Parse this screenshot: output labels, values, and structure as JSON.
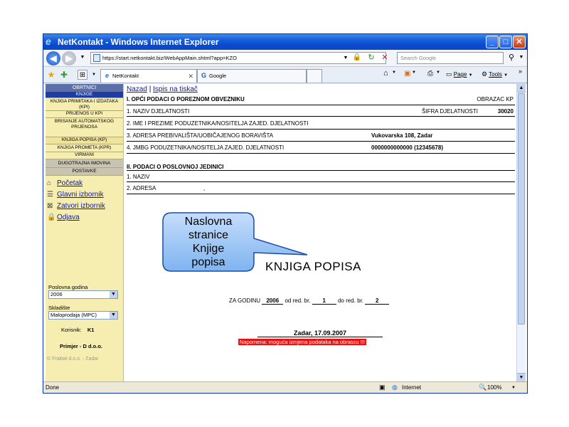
{
  "window": {
    "title": "NetKontakt - Windows Internet Explorer"
  },
  "address_bar": {
    "url": "https://start.netkontakt.biz/WebAppMain.shtml?app=KZO",
    "search_placeholder": "Search Google"
  },
  "tabs": [
    {
      "label": "NetKontakt"
    },
    {
      "label": "Google"
    }
  ],
  "commands": {
    "page": "Page",
    "tools": "Tools"
  },
  "sidebar": {
    "header": "OBRTNICI",
    "items": [
      {
        "label": "KNJIGE"
      },
      {
        "label": "KNJIGA PRIMITAKA I IZDATAKA (KPI)"
      },
      {
        "label": "PRIJENOS U KPI"
      },
      {
        "label": "BRISANJE AUTOMATSKOG PRIJENOSA"
      },
      {
        "label": "KNJIGA POPISA (KP)"
      },
      {
        "label": "KNJIGA PROMETA (KPR)"
      },
      {
        "label": "VIRMANI"
      },
      {
        "label": "DUGOTRAJNA IMOVINA"
      },
      {
        "label": "POSTAVKE"
      }
    ],
    "links": [
      {
        "label": "Početak"
      },
      {
        "label": "Glavni izbornik"
      },
      {
        "label": "Zatvori izbornik"
      },
      {
        "label": "Odjava"
      }
    ],
    "year_label": "Poslovna godina",
    "year_value": "2006",
    "warehouse_label": "Skladište",
    "warehouse_value": "Maloprodaja (MPC)",
    "user_label": "Korisnik:",
    "user_value": "K1",
    "company": "Primjer - D d.o.o.",
    "footer": "© Fraktal d.o.o. - Zadar"
  },
  "main": {
    "nav_back": "Nazad",
    "nav_separator": "|",
    "nav_print": "Ispis na tiskač",
    "section1_title": "I. OPĆI PODACI O POREZNOM OBVEZNIKU",
    "form_code": "OBRAZAC KP",
    "row1_label": "1. NAZIV DJELATNOSTI",
    "row1_code_label": "ŠIFRA DJELATNOSTI",
    "row1_code_value": "30020",
    "row2_label": "2. IME I PREZIME PODUZETNIKA/NOSITELJA ZAJED. DJELATNOSTI",
    "row3_label": "3. ADRESA PREBIVALIŠTA/UOBIČAJENOG BORAVIŠTA",
    "row3_value": "Vukovarska 108, Zadar",
    "row4_label": "4. JMBG PODUZETNIKA/NOSITELJA ZAJED. DJELATNOSTI",
    "row4_value": "0000000000000 (12345678)",
    "section2_title": "II. PODACI O POSLOVNOJ JEDINICI",
    "unit_row1_label": "1. NAZIV",
    "unit_row2_label": "2. ADRESA",
    "unit_row2_value": ",",
    "book_title": "KNJIGA POPISA",
    "year_prefix": "ZA GODINU",
    "year_value": "2006",
    "from_label": "od red. br.",
    "from_value": "1",
    "to_label": "do red. br.",
    "to_value": "2",
    "place_date": "Zadar, 17.09.2007",
    "notice": "Napomena: moguća izmjena podataka na obrascu !!!"
  },
  "callout": {
    "lines": [
      "Naslovna",
      "stranice",
      "Knjige",
      "popisa"
    ]
  },
  "status": {
    "left": "Done",
    "zone": "Internet",
    "zoom": "100%"
  }
}
